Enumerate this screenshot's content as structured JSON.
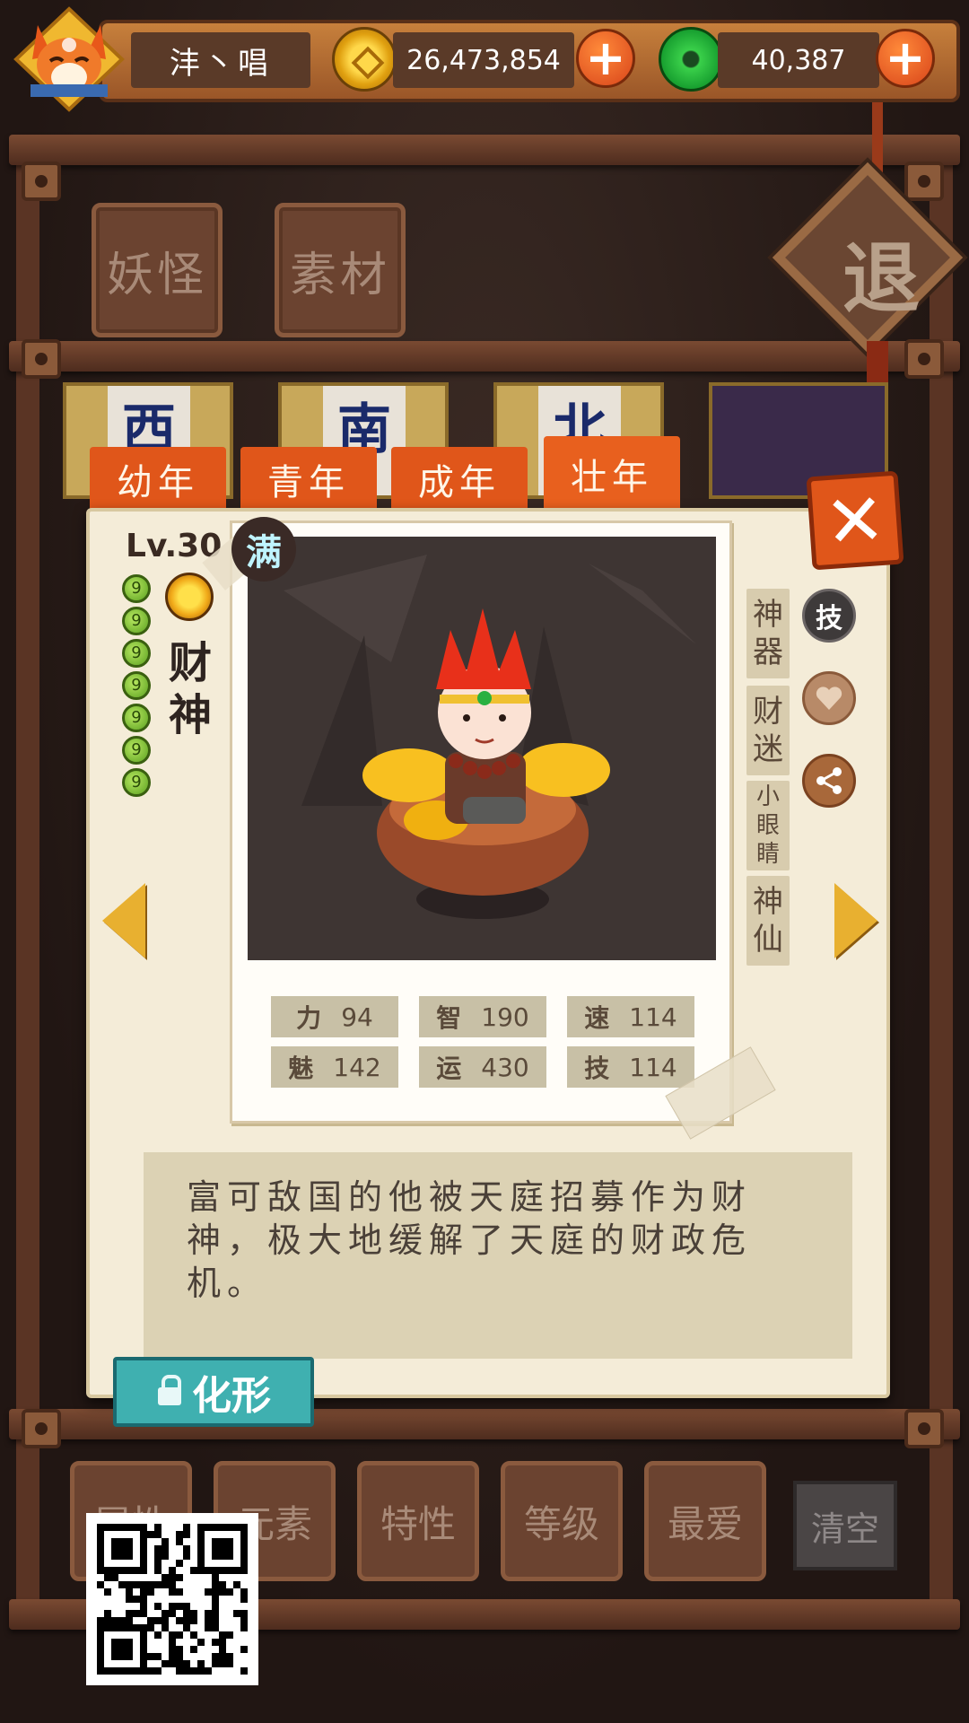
{
  "header": {
    "player_name": "沣丶唱",
    "coins": "26,473,854",
    "jade": "40,387"
  },
  "background": {
    "tabs": [
      "妖怪",
      "素材"
    ],
    "exit_label": "退",
    "bottom_filters": [
      "属性",
      "元素",
      "特性",
      "等级",
      "最爱"
    ],
    "clear_label": "清空"
  },
  "age_tabs": [
    {
      "label": "幼年",
      "active": false
    },
    {
      "label": "青年",
      "active": false
    },
    {
      "label": "成年",
      "active": false
    },
    {
      "label": "壮年",
      "active": true
    }
  ],
  "character": {
    "level": "Lv.30",
    "full_badge": "满",
    "name": "财神",
    "star_count": 7,
    "element_icon": "sun-icon",
    "stats": [
      {
        "key": "力",
        "value": "94"
      },
      {
        "key": "智",
        "value": "190"
      },
      {
        "key": "速",
        "value": "114"
      },
      {
        "key": "魅",
        "value": "142"
      },
      {
        "key": "运",
        "value": "430"
      },
      {
        "key": "技",
        "value": "114"
      }
    ],
    "tags": [
      "神器",
      "财迷",
      "小眼睛",
      "神仙"
    ],
    "side_icons": {
      "skill": "技"
    },
    "description": "富可敌国的他被天庭招募作为财神，极大地缓解了天庭的财政危机。"
  },
  "actions": {
    "transform_label": "化形",
    "close_symbol": "✕"
  },
  "colors": {
    "accent_orange": "#e0561a",
    "panel_bg": "#f4ecd8",
    "teal_button": "#3fb0b0"
  }
}
